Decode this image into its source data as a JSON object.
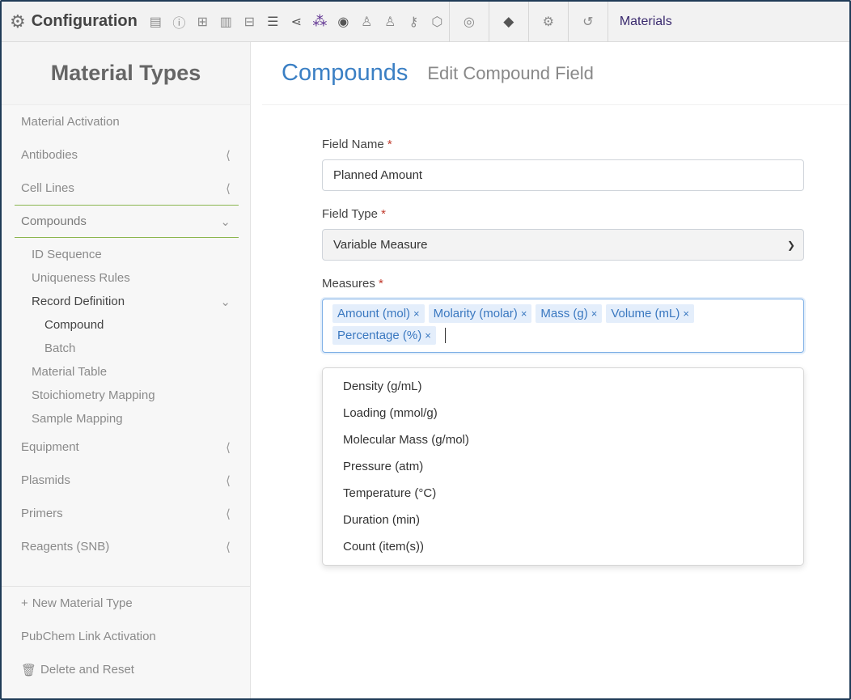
{
  "topbar": {
    "title": "Configuration",
    "materials_label": "Materials",
    "icons": [
      "layout-icon",
      "info-icon",
      "table-icon",
      "document-icon",
      "grid-icon",
      "database-icon",
      "share-icon",
      "molecule-icon",
      "target-icon",
      "users-icon",
      "user-icon",
      "key-icon",
      "cube-icon"
    ],
    "cells": [
      "location-icon",
      "tag-icon",
      "settings-icon",
      "history-icon"
    ]
  },
  "sidebar": {
    "title": "Material Types",
    "items": [
      {
        "label": "Material Activation"
      },
      {
        "label": "Antibodies"
      },
      {
        "label": "Cell Lines"
      },
      {
        "label": "Compounds"
      }
    ],
    "compound_sub": [
      {
        "label": "ID Sequence"
      },
      {
        "label": "Uniqueness Rules"
      },
      {
        "label": "Record Definition"
      }
    ],
    "record_sub": [
      {
        "label": "Compound"
      },
      {
        "label": "Batch"
      }
    ],
    "compound_sub2": [
      {
        "label": "Material Table"
      },
      {
        "label": "Stoichiometry Mapping"
      },
      {
        "label": "Sample Mapping"
      }
    ],
    "items2": [
      {
        "label": "Equipment"
      },
      {
        "label": "Plasmids"
      },
      {
        "label": "Primers"
      },
      {
        "label": "Reagents (SNB)"
      }
    ],
    "actions": {
      "new_type": "New Material Type",
      "pubchem": "PubChem Link Activation",
      "delete_reset": "Delete and Reset"
    }
  },
  "main": {
    "title": "Compounds",
    "subtitle": "Edit Compound Field",
    "field_name_label": "Field Name",
    "field_name_value": "Planned Amount",
    "field_type_label": "Field Type",
    "field_type_value": "Variable Measure",
    "measures_label": "Measures",
    "required_mark": "*",
    "tags": [
      "Amount (mol)",
      "Molarity (molar)",
      "Mass (g)",
      "Volume (mL)",
      "Percentage (%)"
    ],
    "tag_remove": "×",
    "options": [
      "Density (g/mL)",
      "Loading (mmol/g)",
      "Molecular Mass (g/mol)",
      "Pressure (atm)",
      "Temperature (°C)",
      "Duration (min)",
      "Count (item(s))"
    ]
  },
  "colors": {
    "accent": "#3a7fc4",
    "active_border": "#8bb64f",
    "required": "#c0392b"
  }
}
